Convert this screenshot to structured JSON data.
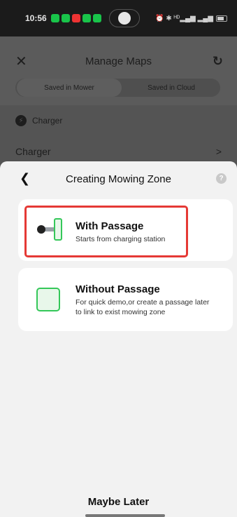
{
  "status_bar": {
    "time": "10:56",
    "right_indicators": "⏰ ✱ ᴴᴰ▂▄▆ ▂▄▆"
  },
  "background_screen": {
    "title": "Manage Maps",
    "tabs": [
      "Saved in Mower",
      "Saved in Cloud"
    ],
    "section_label": "Charger",
    "list_item": "Charger",
    "chevron": ">"
  },
  "sheet": {
    "title": "Creating Mowing Zone",
    "options": [
      {
        "title": "With Passage",
        "description": "Starts from charging station",
        "highlighted": true
      },
      {
        "title": "Without Passage",
        "description": "For quick demo,or create a passage later to link to exist mowing zone"
      }
    ],
    "maybe_later": "Maybe Later"
  },
  "colors": {
    "accent_green": "#34c759",
    "highlight_red": "#e53935",
    "overlay_gray": "#5b5b5b"
  }
}
